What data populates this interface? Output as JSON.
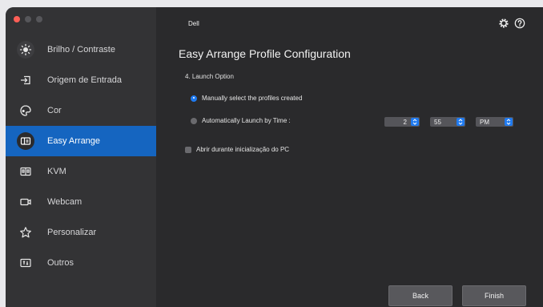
{
  "app": {
    "brand": "Dell"
  },
  "sidebar": {
    "items": [
      {
        "label": "Brilho / Contraste",
        "icon": "brightness-icon",
        "active": false
      },
      {
        "label": "Origem de Entrada",
        "icon": "input-source-icon",
        "active": false
      },
      {
        "label": "Cor",
        "icon": "color-palette-icon",
        "active": false
      },
      {
        "label": "Easy Arrange",
        "icon": "easy-arrange-icon",
        "active": true
      },
      {
        "label": "KVM",
        "icon": "kvm-icon",
        "active": false
      },
      {
        "label": "Webcam",
        "icon": "webcam-icon",
        "active": false
      },
      {
        "label": "Personalizar",
        "icon": "star-icon",
        "active": false
      },
      {
        "label": "Outros",
        "icon": "others-icon",
        "active": false
      }
    ]
  },
  "main": {
    "title": "Easy Arrange Profile Configuration",
    "section": "4. Launch Option",
    "option_manual": "Manually select the profiles created",
    "option_auto": "Automatically Launch by Time :",
    "time": {
      "hour": "2",
      "minute": "55",
      "ampm": "PM"
    },
    "checkbox_label": "Abrir durante inicialização do PC"
  },
  "footer": {
    "back_label": "Back",
    "finish_label": "Finish"
  },
  "colors": {
    "accent": "#1565c0",
    "sidebar_bg": "#333335",
    "content_bg": "#2a2a2c"
  }
}
